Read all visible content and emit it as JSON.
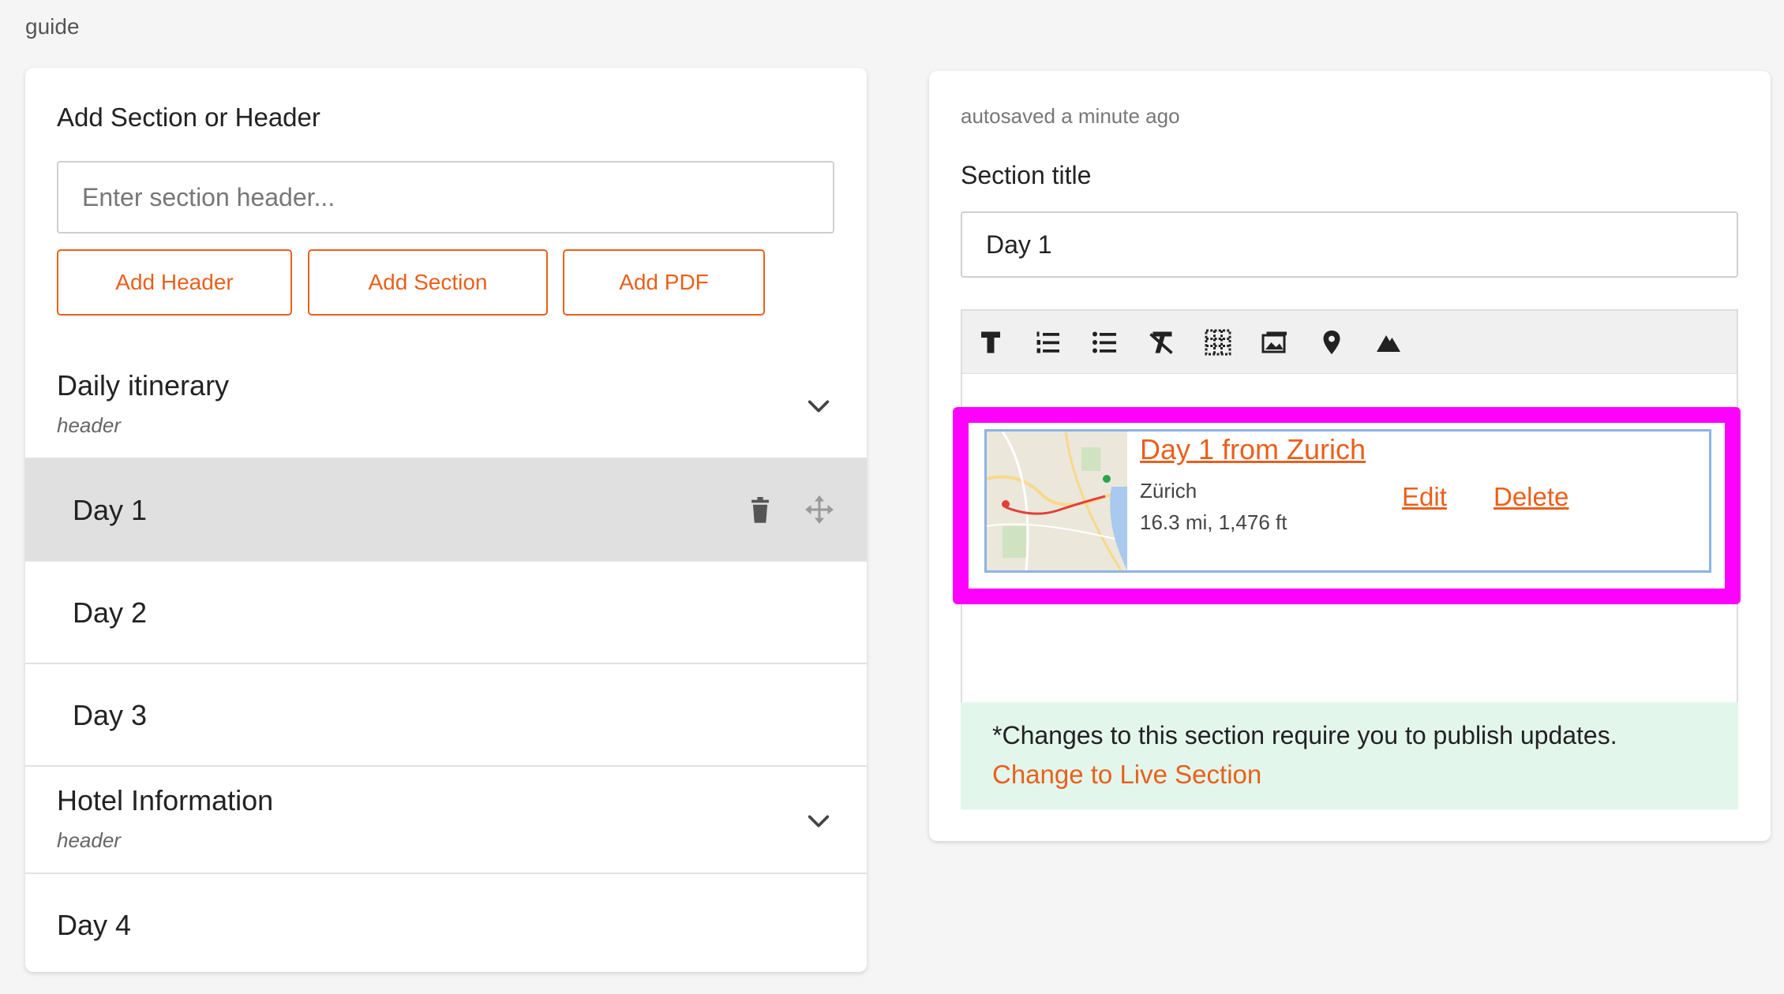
{
  "breadcrumb": "guide",
  "left_panel": {
    "title": "Add Section or Header",
    "input_placeholder": "Enter section header...",
    "buttons": {
      "add_header": "Add Header",
      "add_section": "Add Section",
      "add_pdf": "Add PDF"
    },
    "header1": {
      "title": "Daily itinerary",
      "subtitle": "header"
    },
    "days_group1": [
      {
        "title": "Day 1"
      },
      {
        "title": "Day 2"
      },
      {
        "title": "Day 3"
      }
    ],
    "header2": {
      "title": "Hotel Information",
      "subtitle": "header"
    },
    "day_last": {
      "title": "Day 4"
    }
  },
  "right_panel": {
    "autosave": "autosaved a minute ago",
    "section_title_label": "Section title",
    "section_title_value": "Day 1",
    "toolbar_icons": [
      "text-format-icon",
      "ordered-list-icon",
      "bullet-list-icon",
      "clear-format-icon",
      "table-icon",
      "image-icon",
      "map-pin-icon",
      "mountain-icon"
    ],
    "embed": {
      "title": "Day 1 from Zurich",
      "city": "Zürich",
      "stats": "16.3 mi, 1,476 ft",
      "edit": "Edit",
      "delete": "Delete"
    },
    "notice": {
      "message": "*Changes to this section require you to publish updates.",
      "link": "Change to Live Section"
    }
  },
  "colors": {
    "accent": "#e8601c",
    "highlight": "#ff00ff",
    "notice_bg": "#e3f6ec",
    "active_row": "#e0e0e0"
  }
}
